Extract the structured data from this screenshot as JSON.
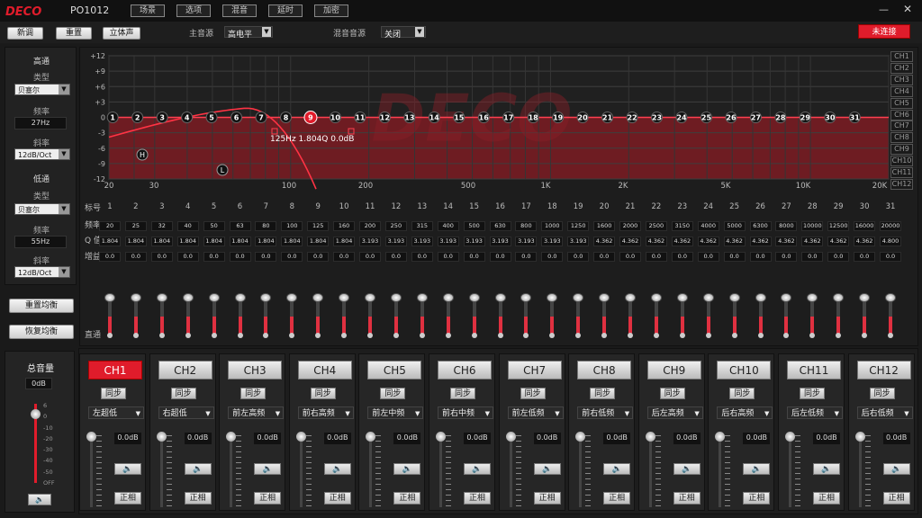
{
  "app": {
    "logo": "DECO",
    "model": "PO1012",
    "menu": [
      "场景",
      "选项",
      "混音",
      "延时",
      "加密"
    ],
    "minimize": "—",
    "close": "✕"
  },
  "toolbar": {
    "new": "新调",
    "reset": "重置",
    "stereo": "立体声",
    "main_src_label": "主音源",
    "main_src": "高电平",
    "mix_src_label": "混音音源",
    "mix_src": "关闭",
    "connect": "未连接"
  },
  "colors": {
    "accent": "#e01c2b"
  },
  "left": {
    "hp_title": "高通",
    "type_label": "类型",
    "hp_type": "贝塞尔",
    "freq_label": "频率",
    "hp_freq": "27Hz",
    "slope_label": "斜率",
    "hp_slope": "12dB/Oct",
    "lp_title": "低通",
    "lp_type": "贝塞尔",
    "lp_freq": "55Hz",
    "lp_slope": "12dB/Oct",
    "reset_eq": "重置均衡",
    "restore_eq": "恢复均衡"
  },
  "graph": {
    "y_labels": [
      "+12",
      "+9",
      "+6",
      "+3",
      "0",
      "-3",
      "-6",
      "-9",
      "-12"
    ],
    "x_labels": [
      "20",
      "30",
      "100",
      "200",
      "500",
      "1K",
      "2K",
      "5K",
      "10K",
      "20K"
    ],
    "ch_tabs": [
      "CH1",
      "CH2",
      "CH3",
      "CH4",
      "CH5",
      "CH6",
      "CH7",
      "CH8",
      "CH9",
      "CH10",
      "CH11",
      "CH12"
    ],
    "tooltip": "125Hz  1.804Q  0.0dB",
    "hp_marker": "H",
    "lp_marker": "L",
    "selected_point": 9
  },
  "eq": {
    "row_labels": [
      "标号",
      "频率",
      "Q 值",
      "增益",
      "直通"
    ],
    "freqs": [
      "20",
      "25",
      "32",
      "40",
      "50",
      "63",
      "80",
      "100",
      "125",
      "160",
      "200",
      "250",
      "315",
      "400",
      "500",
      "630",
      "800",
      "1000",
      "1250",
      "1600",
      "2000",
      "2500",
      "3150",
      "4000",
      "5000",
      "6300",
      "8000",
      "10000",
      "12500",
      "16000",
      "20000"
    ],
    "q": [
      "1.804",
      "1.804",
      "1.804",
      "1.804",
      "1.804",
      "1.804",
      "1.804",
      "1.804",
      "1.804",
      "1.804",
      "3.193",
      "3.193",
      "3.193",
      "3.193",
      "3.193",
      "3.193",
      "3.193",
      "3.193",
      "3.193",
      "4.362",
      "4.362",
      "4.362",
      "4.362",
      "4.362",
      "4.362",
      "4.362",
      "4.362",
      "4.362",
      "4.362",
      "4.362",
      "4.800"
    ],
    "gain": "0.0"
  },
  "master": {
    "title": "总音量",
    "value": "0dB",
    "scale": [
      "6",
      "0",
      "-10",
      "-20",
      "-30",
      "-40",
      "-50",
      "OFF"
    ],
    "mute": "🔈"
  },
  "channels": [
    {
      "name": "CH1",
      "sync": "同步",
      "source": "左超低",
      "db": "0.0dB",
      "mute": "🔈",
      "phase": "正相"
    },
    {
      "name": "CH2",
      "sync": "同步",
      "source": "右超低",
      "db": "0.0dB",
      "mute": "🔈",
      "phase": "正相"
    },
    {
      "name": "CH3",
      "sync": "同步",
      "source": "前左高频",
      "db": "0.0dB",
      "mute": "🔈",
      "phase": "正相"
    },
    {
      "name": "CH4",
      "sync": "同步",
      "source": "前右高频",
      "db": "0.0dB",
      "mute": "🔈",
      "phase": "正相"
    },
    {
      "name": "CH5",
      "sync": "同步",
      "source": "前左中频",
      "db": "0.0dB",
      "mute": "🔈",
      "phase": "正相"
    },
    {
      "name": "CH6",
      "sync": "同步",
      "source": "前右中频",
      "db": "0.0dB",
      "mute": "🔈",
      "phase": "正相"
    },
    {
      "name": "CH7",
      "sync": "同步",
      "source": "前左低频",
      "db": "0.0dB",
      "mute": "🔈",
      "phase": "正相"
    },
    {
      "name": "CH8",
      "sync": "同步",
      "source": "前右低频",
      "db": "0.0dB",
      "mute": "🔈",
      "phase": "正相"
    },
    {
      "name": "CH9",
      "sync": "同步",
      "source": "后左高频",
      "db": "0.0dB",
      "mute": "🔈",
      "phase": "正相"
    },
    {
      "name": "CH10",
      "sync": "同步",
      "source": "后右高频",
      "db": "0.0dB",
      "mute": "🔈",
      "phase": "正相"
    },
    {
      "name": "CH11",
      "sync": "同步",
      "source": "后左低频",
      "db": "0.0dB",
      "mute": "🔈",
      "phase": "正相"
    },
    {
      "name": "CH12",
      "sync": "同步",
      "source": "后右低频",
      "db": "0.0dB",
      "mute": "🔈",
      "phase": "正相"
    }
  ]
}
